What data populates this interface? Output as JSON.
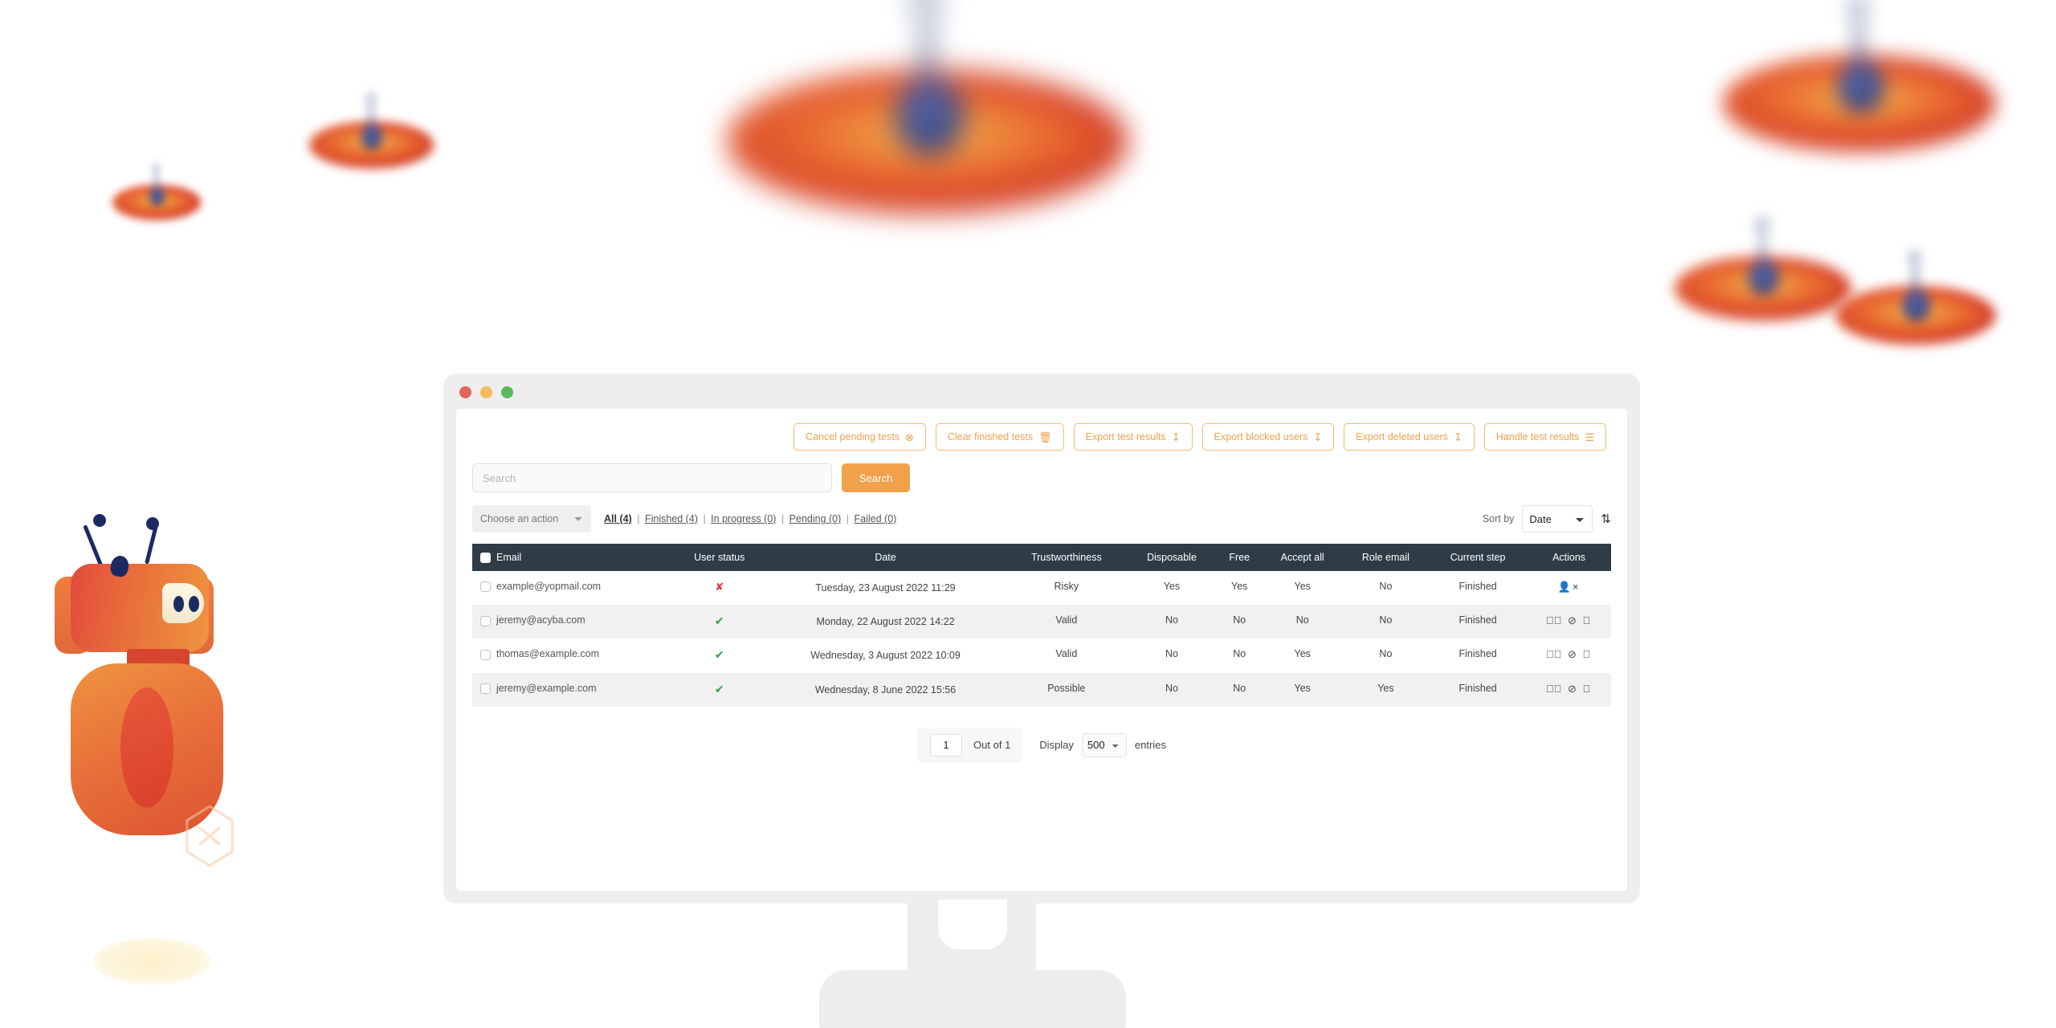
{
  "colors": {
    "accent": "#f0a14a",
    "accent_border": "#f5b870",
    "table_header_bg": "#2e3c48",
    "status_ok": "#2f9e44",
    "status_bad": "#e03131",
    "row_alt_bg": "#f1f1f1"
  },
  "window": {
    "dots": [
      "close-dot",
      "minimize-dot",
      "zoom-dot"
    ]
  },
  "toolbar": {
    "buttons": [
      {
        "label": "Cancel pending tests",
        "icon": "⊗",
        "icon_name": "cancel-circle-icon"
      },
      {
        "label": "Clear finished tests",
        "icon": "🗑",
        "icon_name": "trash-icon"
      },
      {
        "label": "Export test results",
        "icon": "↧",
        "icon_name": "download-icon"
      },
      {
        "label": "Export blocked users",
        "icon": "↧",
        "icon_name": "download-icon"
      },
      {
        "label": "Export deleted users",
        "icon": "↧",
        "icon_name": "download-icon"
      },
      {
        "label": "Handle test results",
        "icon": "☰",
        "icon_name": "list-icon"
      }
    ]
  },
  "search": {
    "placeholder": "Search",
    "value": "",
    "button_label": "Search"
  },
  "filters": {
    "choose_action_label": "Choose an action",
    "choose_action_options": [
      "Choose an action"
    ],
    "status_links": [
      {
        "label": "All (4)",
        "active": true
      },
      {
        "label": "Finished (4)",
        "active": false
      },
      {
        "label": "In progress (0)",
        "active": false
      },
      {
        "label": "Pending (0)",
        "active": false
      },
      {
        "label": "Failed (0)",
        "active": false
      }
    ],
    "separator": "|"
  },
  "sort": {
    "label": "Sort by",
    "value": "Date",
    "options": [
      "Date"
    ],
    "direction_icon": "⇅",
    "direction_icon_name": "sort-descending-icon"
  },
  "table": {
    "columns": [
      "Email",
      "User status",
      "Date",
      "Trustworthiness",
      "Disposable",
      "Free",
      "Accept all",
      "Role email",
      "Current step",
      "Actions"
    ],
    "rows": [
      {
        "email": "example@yopmail.com",
        "user_status": "✘",
        "user_status_state": "invalid",
        "date": "Tuesday, 23 August 2022 11:29",
        "trustworthiness": "Risky",
        "disposable": "Yes",
        "free": "Yes",
        "accept_all": "Yes",
        "role_email": "No",
        "current_step": "Finished",
        "actions": [
          "user-remove-icon"
        ],
        "action_glyphs": "👤×"
      },
      {
        "email": "jeremy@acyba.com",
        "user_status": "✔",
        "user_status_state": "valid",
        "date": "Monday, 22 August 2022 14:22",
        "trustworthiness": "Valid",
        "disposable": "No",
        "free": "No",
        "accept_all": "No",
        "role_email": "No",
        "current_step": "Finished",
        "actions": [
          "check-circle-icon",
          "ban-icon",
          "trash-icon"
        ],
        "action_glyphs": "✔⃝ ⊘ 🗑"
      },
      {
        "email": "thomas@example.com",
        "user_status": "✔",
        "user_status_state": "valid",
        "date": "Wednesday, 3 August 2022 10:09",
        "trustworthiness": "Valid",
        "disposable": "No",
        "free": "No",
        "accept_all": "Yes",
        "role_email": "No",
        "current_step": "Finished",
        "actions": [
          "check-circle-icon",
          "ban-icon",
          "trash-icon"
        ],
        "action_glyphs": "✔⃝ ⊘ 🗑"
      },
      {
        "email": "jeremy@example.com",
        "user_status": "✔",
        "user_status_state": "valid",
        "date": "Wednesday, 8 June 2022 15:56",
        "trustworthiness": "Possible",
        "disposable": "No",
        "free": "No",
        "accept_all": "Yes",
        "role_email": "Yes",
        "current_step": "Finished",
        "actions": [
          "check-circle-icon",
          "ban-icon",
          "trash-icon"
        ],
        "action_glyphs": "✔⃝ ⊘ 🗑"
      }
    ]
  },
  "pagination": {
    "page_value": "1",
    "out_of_label": "Out of 1",
    "display_label": "Display",
    "entries_value": "500",
    "entries_options": [
      "500"
    ],
    "entries_label": "entries"
  }
}
